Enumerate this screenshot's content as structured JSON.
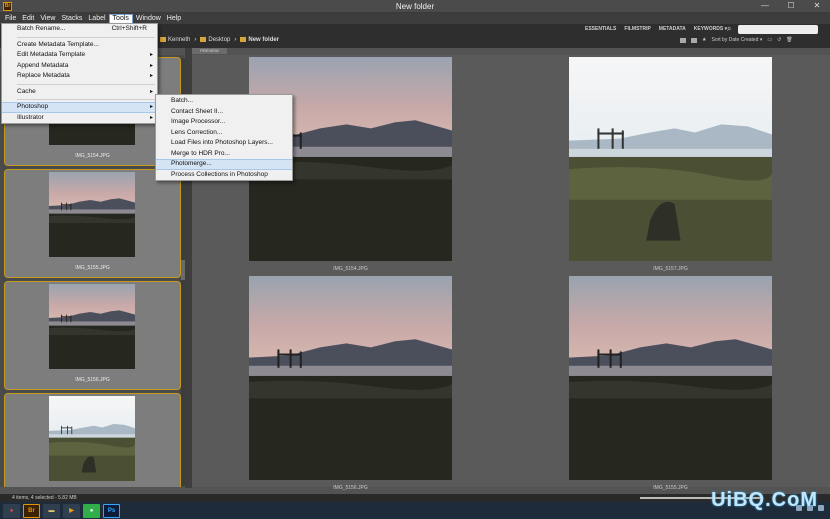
{
  "window": {
    "title": "New folder",
    "app_icon": "Br",
    "controls": [
      "—",
      "☐",
      "✕"
    ]
  },
  "menubar": {
    "items": [
      "File",
      "Edit",
      "View",
      "Stacks",
      "Label",
      "Tools",
      "Window",
      "Help"
    ],
    "active": "Tools"
  },
  "pathbar": {
    "crumbs": [
      "Kenneth",
      "Desktop",
      "New folder"
    ]
  },
  "workspaces": [
    "ESSENTIALS",
    "FILMSTRIP",
    "METADATA",
    "KEYWORDS ▾"
  ],
  "sort": {
    "label": "Sort by Date Created ▾"
  },
  "content_tab": "PREVIEW",
  "tools_menu": {
    "items": [
      {
        "label": "Batch Rename...",
        "shortcut": "Ctrl+Shift+R"
      },
      {
        "sep": true
      },
      {
        "label": "Create Metadata Template..."
      },
      {
        "label": "Edit Metadata Template",
        "submenu": true
      },
      {
        "label": "Append Metadata",
        "submenu": true
      },
      {
        "label": "Replace Metadata",
        "submenu": true
      },
      {
        "sep": true
      },
      {
        "label": "Cache",
        "submenu": true
      },
      {
        "sep": true
      },
      {
        "label": "Photoshop",
        "submenu": true,
        "highlight": true
      },
      {
        "label": "Illustrator",
        "submenu": true
      }
    ]
  },
  "photoshop_submenu": {
    "items": [
      "Batch...",
      "Contact Sheet II...",
      "Image Processor...",
      "Lens Correction...",
      "Load Files into Photoshop Layers...",
      "Merge to HDR Pro...",
      "Photomerge...",
      "Process Collections in Photoshop"
    ],
    "highlight": "Photomerge..."
  },
  "thumbnails": [
    "IMG_5154.JPG",
    "IMG_5155.JPG",
    "IMG_5156.JPG"
  ],
  "previews": [
    "IMG_5154.JPG",
    "IMG_5157.JPG",
    "IMG_5156.JPG",
    "IMG_5155.JPG"
  ],
  "status": "4 items, 4 selected - 5.82 MB",
  "taskbar": [
    "chrome",
    "bridge",
    "explorer",
    "media",
    "line",
    "photoshop"
  ],
  "watermark": "UiBQ.CoM"
}
